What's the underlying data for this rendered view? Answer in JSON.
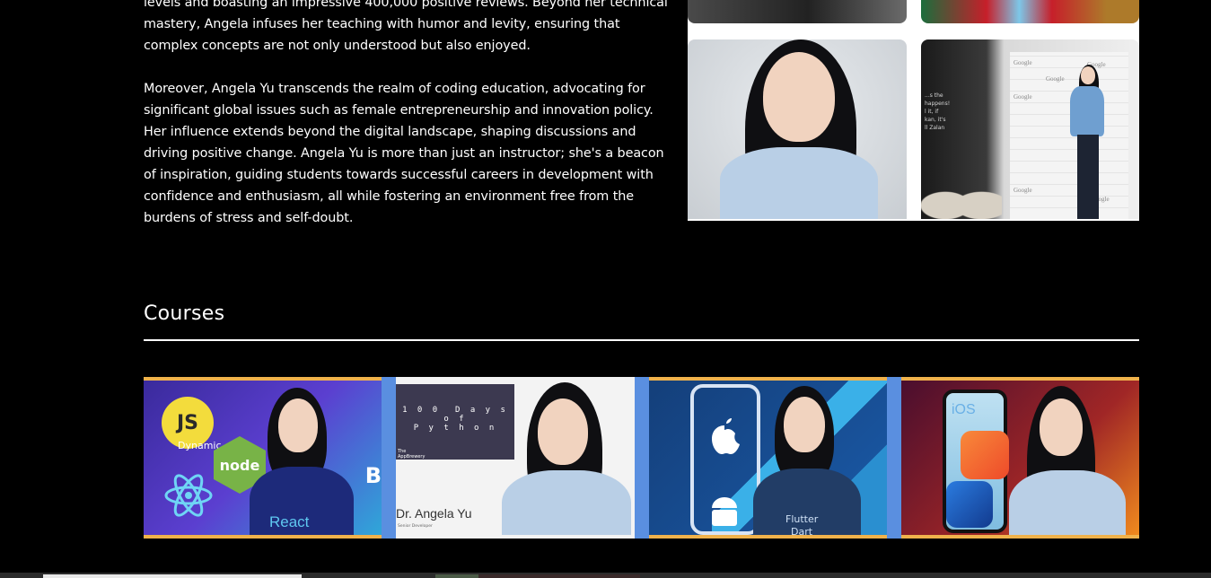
{
  "bio": {
    "paragraphs": [
      "levels and boasting an impressive 400,000 positive reviews. Beyond her technical mastery, Angela infuses her teaching with humor and levity, ensuring that complex concepts are not only understood but also enjoyed.",
      "Moreover, Angela Yu transcends the realm of coding education, advocating for significant global issues such as female entrepreneurship and innovation policy. Her influence extends beyond the digital landscape, shaping discussions and driving positive change. Angela Yu is more than just an instructor; she's a beacon of inspiration, guiding students towards successful careers in development with confidence and enthusiasm, all while fostering an environment free from the burdens of stress and self-doubt."
    ]
  },
  "gallery": {
    "stage_screen_text": "...s the\nhappens!\nl it, if\nkan, it's\nll Zalan",
    "wall_logo": "Google"
  },
  "courses": {
    "title": "Courses",
    "items": [
      {
        "id": "web-dev",
        "js_label": "JS",
        "node_label": "node",
        "react_label": "React",
        "dynamic_label": "Dynamic",
        "b_letter": "B"
      },
      {
        "id": "python",
        "box_title": "1 0 0  D a y s\no f\nP y t h o n",
        "box_tiny": "The\nAppBrewery",
        "name": "Dr. Angela Yu",
        "name_sub": "Senior Developer"
      },
      {
        "id": "flutter",
        "flutter_label": "Flutter",
        "dart_label": "Dart"
      },
      {
        "id": "ios",
        "ios_label": "iOS"
      }
    ]
  },
  "colors": {
    "background": "#000000",
    "text": "#ffffff",
    "course_strip": "#5a8fe0",
    "card_trim": "#f0b24b"
  }
}
